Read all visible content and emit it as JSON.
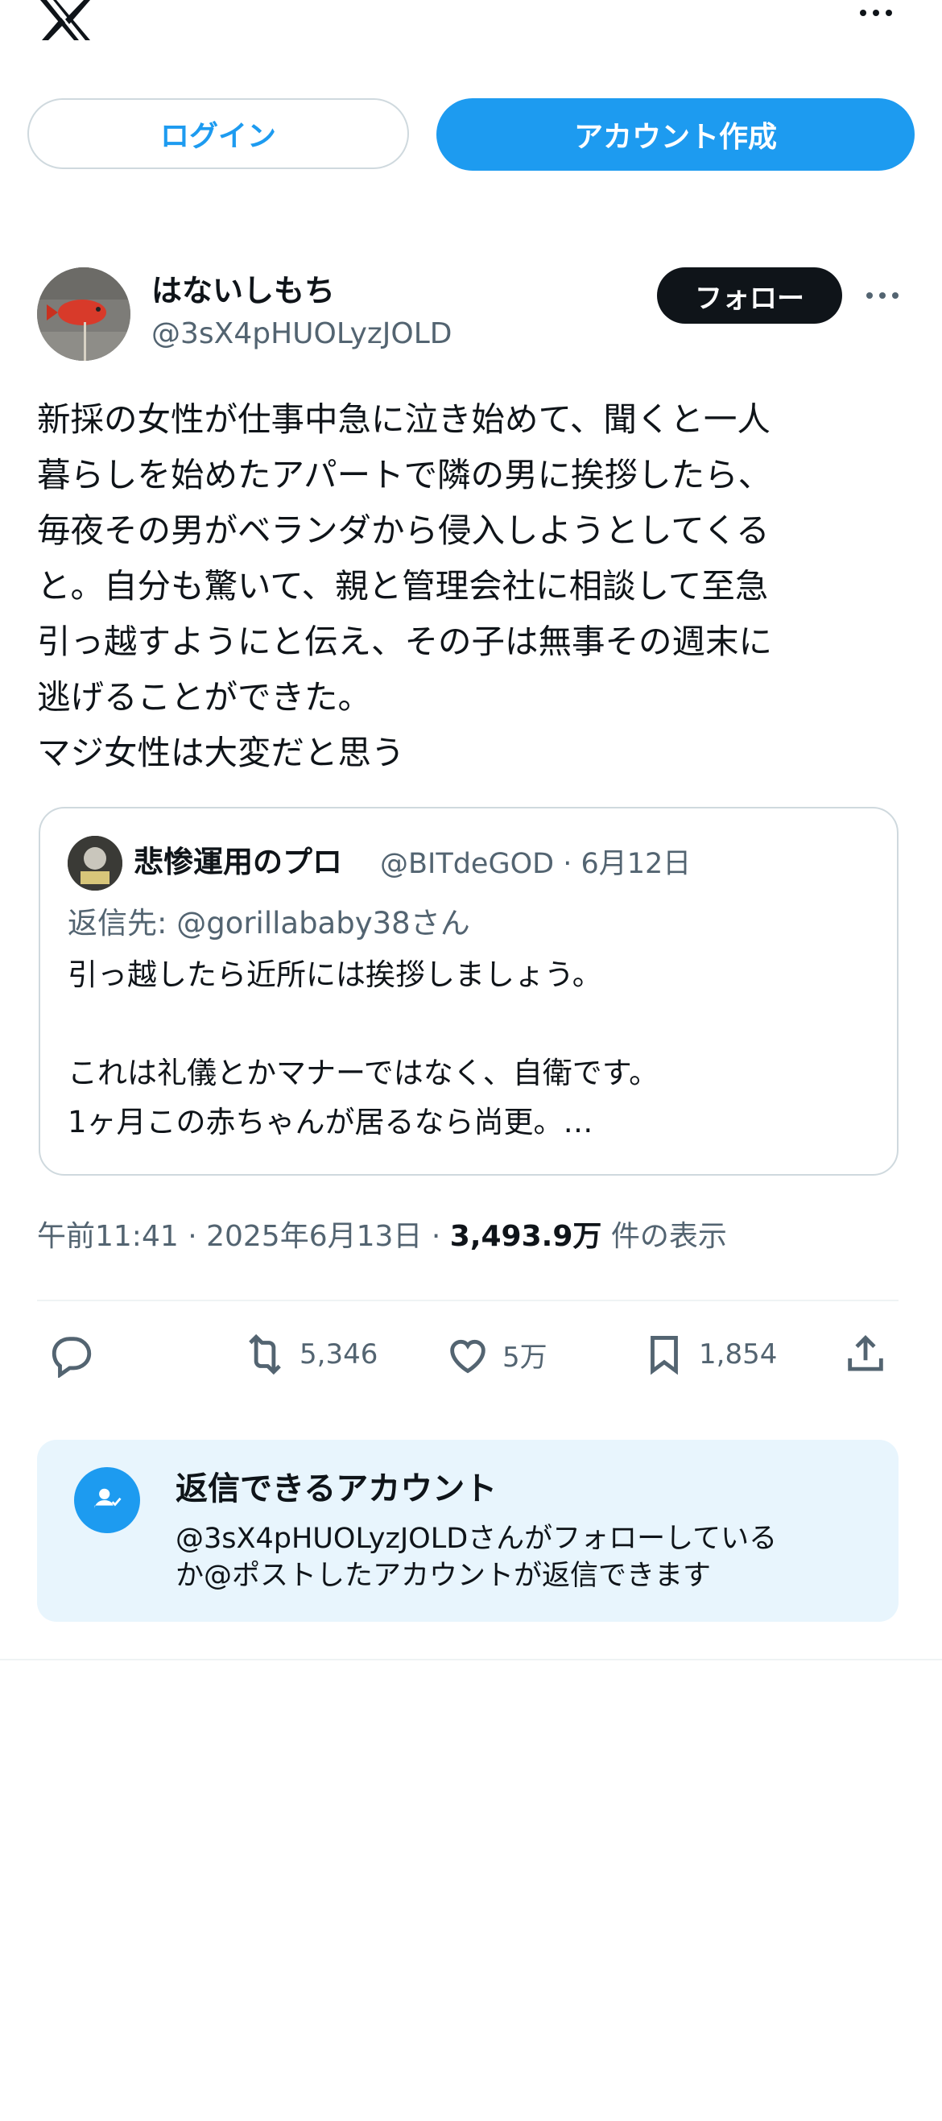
{
  "top_bar": {
    "logo": "x-logo",
    "menu_icon": "more-horizontal-icon"
  },
  "auth": {
    "login_label": "ログイン",
    "signup_label": "アカウント作成"
  },
  "post": {
    "display_name": "はないしもち",
    "handle": "@3sX4pHUOLyzJOLD",
    "follow_label": "フォロー",
    "text": "新採の女性が仕事中急に泣き始めて、聞くと一人\n暮らしを始めたアパートで隣の男に挨拶したら、\n毎夜その男がベランダから侵入しようとしてくる\nと。自分も驚いて、親と管理会社に相談して至急\n引っ越すようにと伝え、その子は無事その週末に\n逃げることができた。\nマジ女性は大変だと思う",
    "time": "午前11:41",
    "date": "2025年6月13日",
    "views_count": "3,493.9万",
    "views_label": "件の表示"
  },
  "quote": {
    "display_name": "悲惨運用のプロ",
    "handle_date": "@BITdeGOD · 6月12日",
    "reply_to": "返信先: @gorillababy38さん",
    "text": "引っ越したら近所には挨拶しましょう。\n\nこれは礼儀とかマナーではなく、自衛です。\n1ヶ月この赤ちゃんが居るなら尚更。…"
  },
  "actions": {
    "reply_count": "",
    "repost_count": "5,346",
    "like_count": "5万",
    "bookmark_count": "1,854"
  },
  "reply_info": {
    "title": "返信できるアカウント",
    "description": "@3sX4pHUOLyzJOLDさんがフォローしている\nか@ポストしたアカウントが返信できます"
  },
  "colors": {
    "accent": "#1d9bf0",
    "text_primary": "#0f1419",
    "text_secondary": "#536471",
    "border": "#cfd9de",
    "info_bg": "#e8f5fd"
  }
}
